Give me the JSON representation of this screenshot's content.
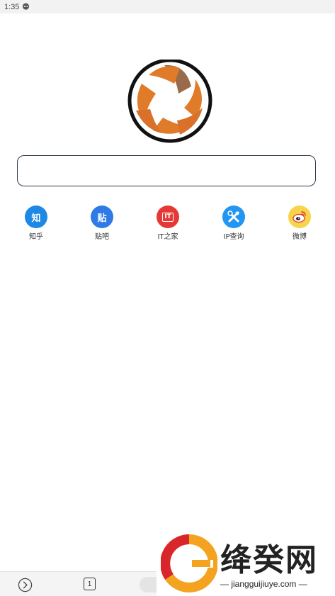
{
  "status_bar": {
    "time": "1:35",
    "notification_icon": "chat-bubble-icon"
  },
  "logo": {
    "icon": "aperture-logo-icon",
    "colors": [
      "#e07b2a",
      "#9a6b4a",
      "#111111"
    ]
  },
  "search": {
    "placeholder": ""
  },
  "shortcuts": [
    {
      "label": "知乎",
      "glyph": "知",
      "icon": "zhihu-icon",
      "color": "#1e88e5"
    },
    {
      "label": "贴吧",
      "glyph": "贴",
      "icon": "tieba-icon",
      "color": "#2f7ae5"
    },
    {
      "label": "IT之家",
      "glyph": "IT",
      "icon": "ithome-icon",
      "color": "#e53935"
    },
    {
      "label": "IP查询",
      "glyph": "",
      "icon": "tools-icon",
      "color": "#2196f3"
    },
    {
      "label": "微博",
      "glyph": "",
      "icon": "weibo-icon",
      "color": "#f7d44a"
    }
  ],
  "bottom_bar": {
    "tab_count": "1",
    "forward_icon": "chevron-right-icon"
  },
  "watermark": {
    "title": "绛癸网",
    "url": "— jiangguijiuye.com —"
  }
}
